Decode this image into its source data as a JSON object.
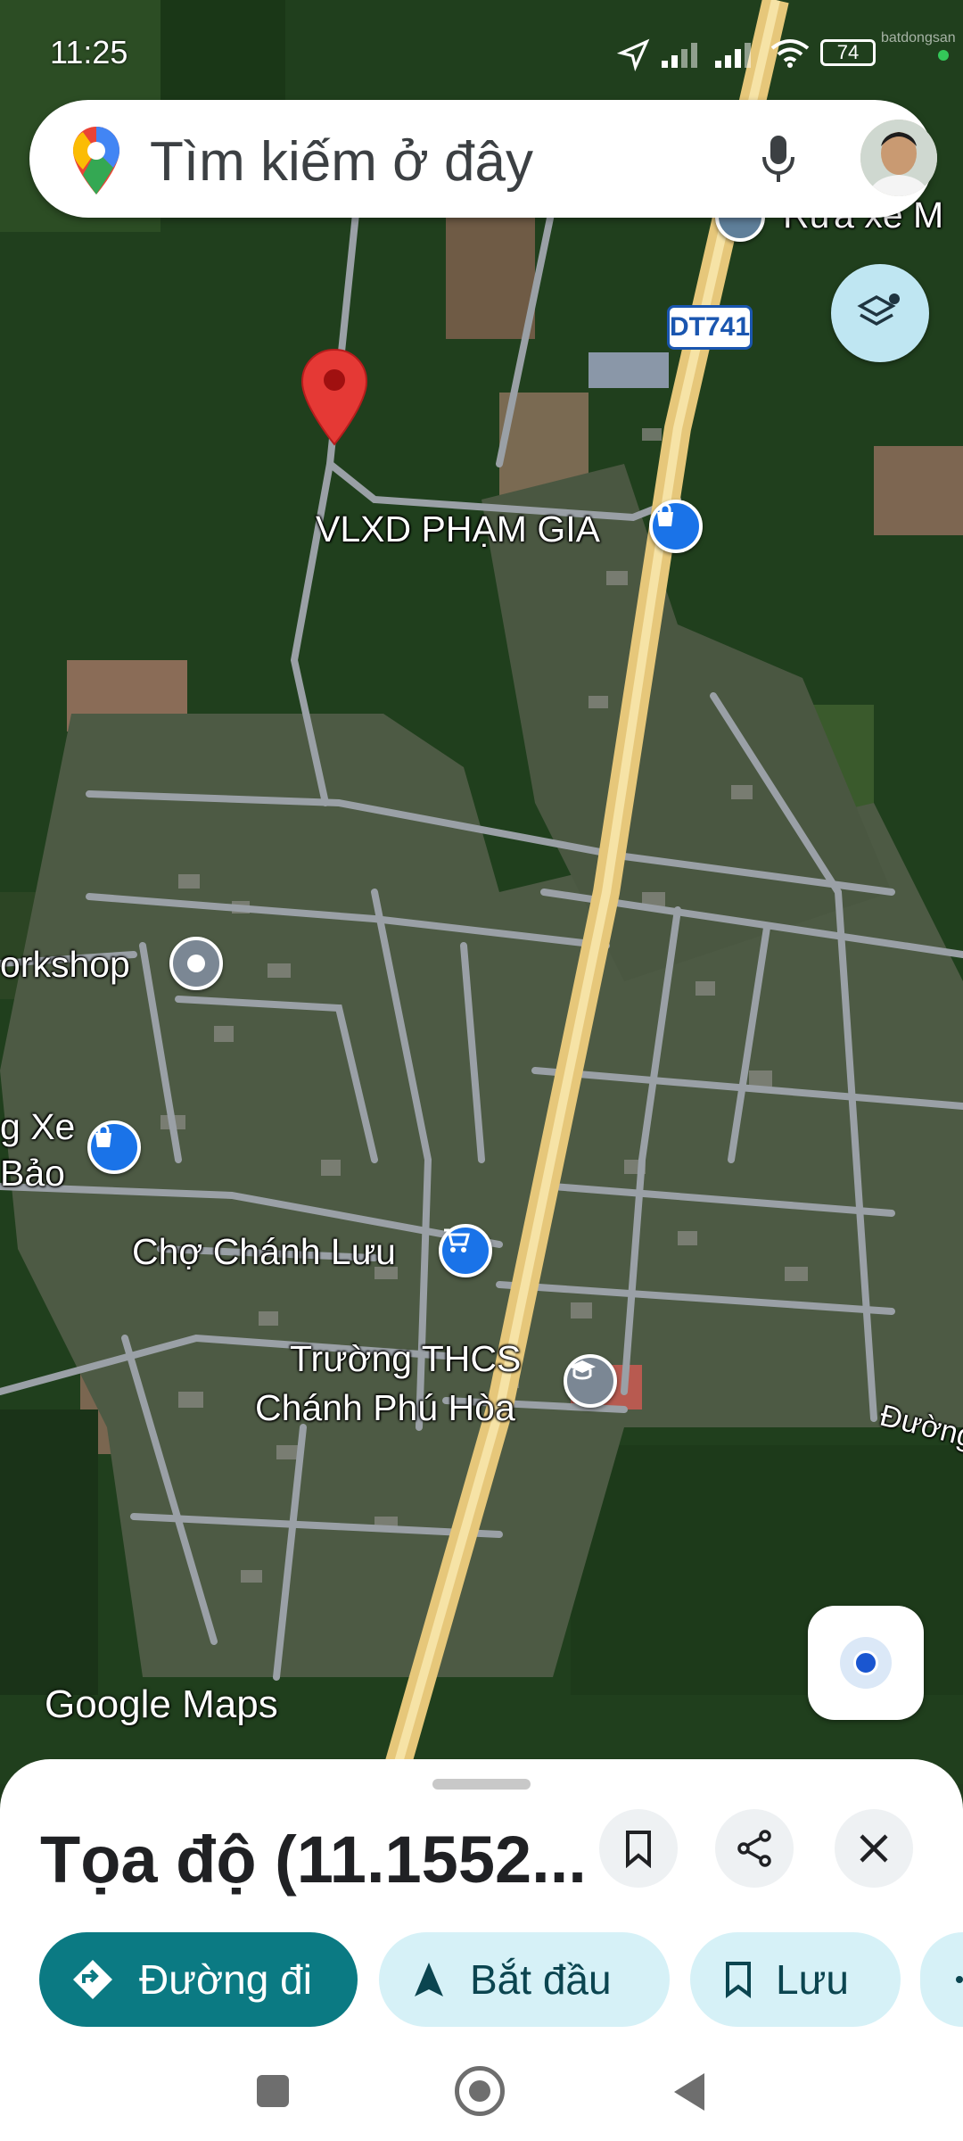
{
  "status_bar": {
    "time": "11:25",
    "battery": "74",
    "watermark": "batdongsan"
  },
  "search": {
    "placeholder": "Tìm kiếm ở đây"
  },
  "map": {
    "road_shield": "DT741",
    "labels": {
      "rua_xe": "Rửa xe M",
      "vlxd": "VLXD PHẠM GIA",
      "workshop": "orkshop",
      "rua_xe_bao_1": "g Xe",
      "rua_xe_bao_2": "Bảo",
      "cho": "Chợ Chánh Lưu",
      "truong_1": "Trường THCS",
      "truong_2": "Chánh Phú Hòa",
      "duong": "Đường"
    },
    "attribution": "Google Maps"
  },
  "sheet": {
    "title": "Tọa độ (11.1552...",
    "actions": {
      "directions": "Đường đi",
      "start": "Bắt đầu",
      "save": "Lưu"
    }
  },
  "colors": {
    "accent": "#0b7a83",
    "pill_bg": "#d6f1f7",
    "pin": "#e53935",
    "road": "#e6c77a"
  }
}
